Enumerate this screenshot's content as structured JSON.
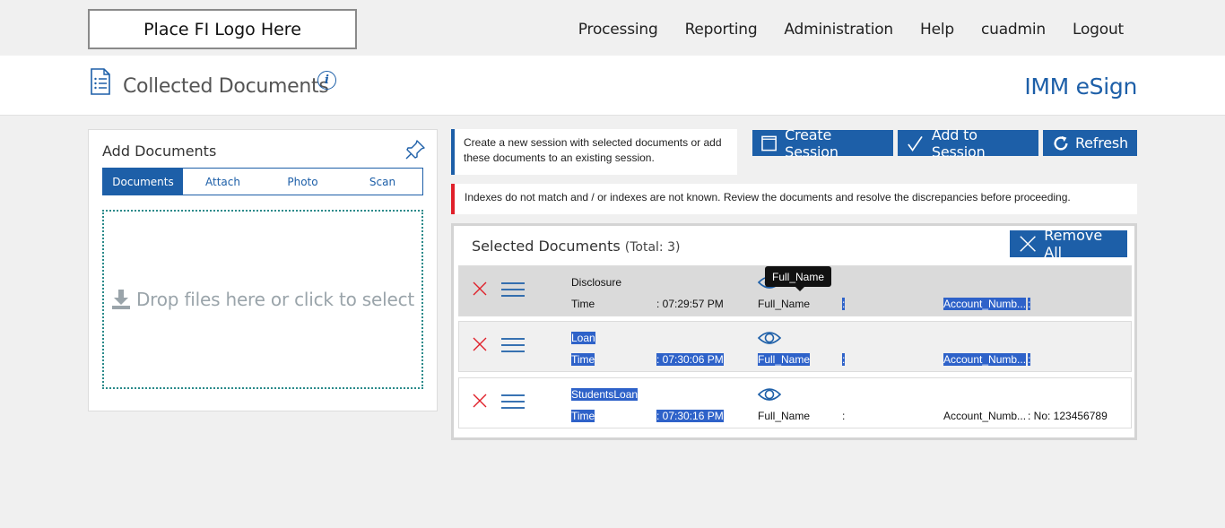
{
  "header": {
    "logo_text": "Place FI Logo Here",
    "nav": [
      "Processing",
      "Reporting",
      "Administration",
      "Help",
      "cuadmin",
      "Logout"
    ]
  },
  "titlebar": {
    "title": "Collected Documents",
    "info": "i",
    "brand": "IMM eSign"
  },
  "add_documents": {
    "title": "Add Documents",
    "tabs": [
      "Documents",
      "Attach",
      "Photo",
      "Scan"
    ],
    "active_tab": "Documents",
    "drop_text": "Drop files here or click to select"
  },
  "info_message": "Create a new session with selected documents or add these documents to an existing session.",
  "actions": {
    "create_session": "Create Session",
    "add_to_session": "Add to Session",
    "refresh": "Refresh"
  },
  "error_message": "Indexes do not match and / or indexes are not known. Review the documents and resolve the discrepancies before proceeding.",
  "selected": {
    "title": "Selected Documents",
    "total": "(Total: 3)",
    "remove_all": "Remove All",
    "rows": [
      {
        "name": "Disclosure",
        "time_label": "Time",
        "time_value": ": 07:29:57 PM",
        "fullname_label": "Full_Name",
        "fullname_value": ":",
        "account_label": "Account_Numb...",
        "account_value": ":"
      },
      {
        "name": "Loan",
        "time_label": "Time",
        "time_value": ": 07:30:06 PM",
        "fullname_label": "Full_Name",
        "fullname_value": ":",
        "account_label": "Account_Numb...",
        "account_value": ":"
      },
      {
        "name": "StudentsLoan",
        "time_label": "Time",
        "time_value": ": 07:30:16 PM",
        "fullname_label": "Full_Name",
        "fullname_value": ":",
        "account_label": "Account_Numb...",
        "account_value": ": No: 123456789"
      }
    ]
  },
  "tooltip": "Full_Name",
  "colors": {
    "primary": "#1d5fa8",
    "error": "#e0202a",
    "highlight": "#2e62c9",
    "remove": "#e0202a"
  }
}
